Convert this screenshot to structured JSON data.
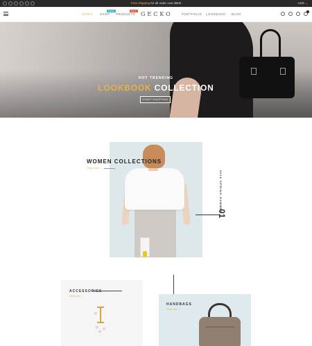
{
  "topbar": {
    "promo_prefix": "Free shipping",
    "promo_suffix": " for all order over $500",
    "currency": "USD ⌄",
    "social_icons": [
      "facebook-icon",
      "twitter-icon",
      "instagram-icon",
      "pinterest-icon",
      "google-icon",
      "linkedin-icon"
    ]
  },
  "nav": {
    "links": [
      "DEMO",
      "SHOP",
      "PRODUCTS",
      "PORTFOLIO",
      "LOOKBOOK",
      "BLOG"
    ],
    "badges": {
      "shop": "NEW",
      "products": "HOT"
    },
    "logo": "GECKO",
    "icons": [
      "search-icon",
      "user-icon",
      "heart-icon",
      "cart-icon"
    ]
  },
  "hero": {
    "subtitle": "HOT TRENDING",
    "title_accent": "LOOKBOOK",
    "title_rest": " COLLECTION",
    "button": "START SHOPPING"
  },
  "women": {
    "title": "WOMEN COLLECTIONS",
    "link": "Shop now →",
    "season": "2018 SPRING-SUMMER",
    "number": "01"
  },
  "accessories": {
    "title": "ACCESSORIES",
    "link": "Shop now →"
  },
  "handbags": {
    "title": "HANDBAGS",
    "link": "Shop now →"
  },
  "colors": {
    "accent": "#e8b14a",
    "topbar": "#2a2a2a",
    "badge_new": "#39b0d9",
    "badge_hot": "#e95b35"
  }
}
